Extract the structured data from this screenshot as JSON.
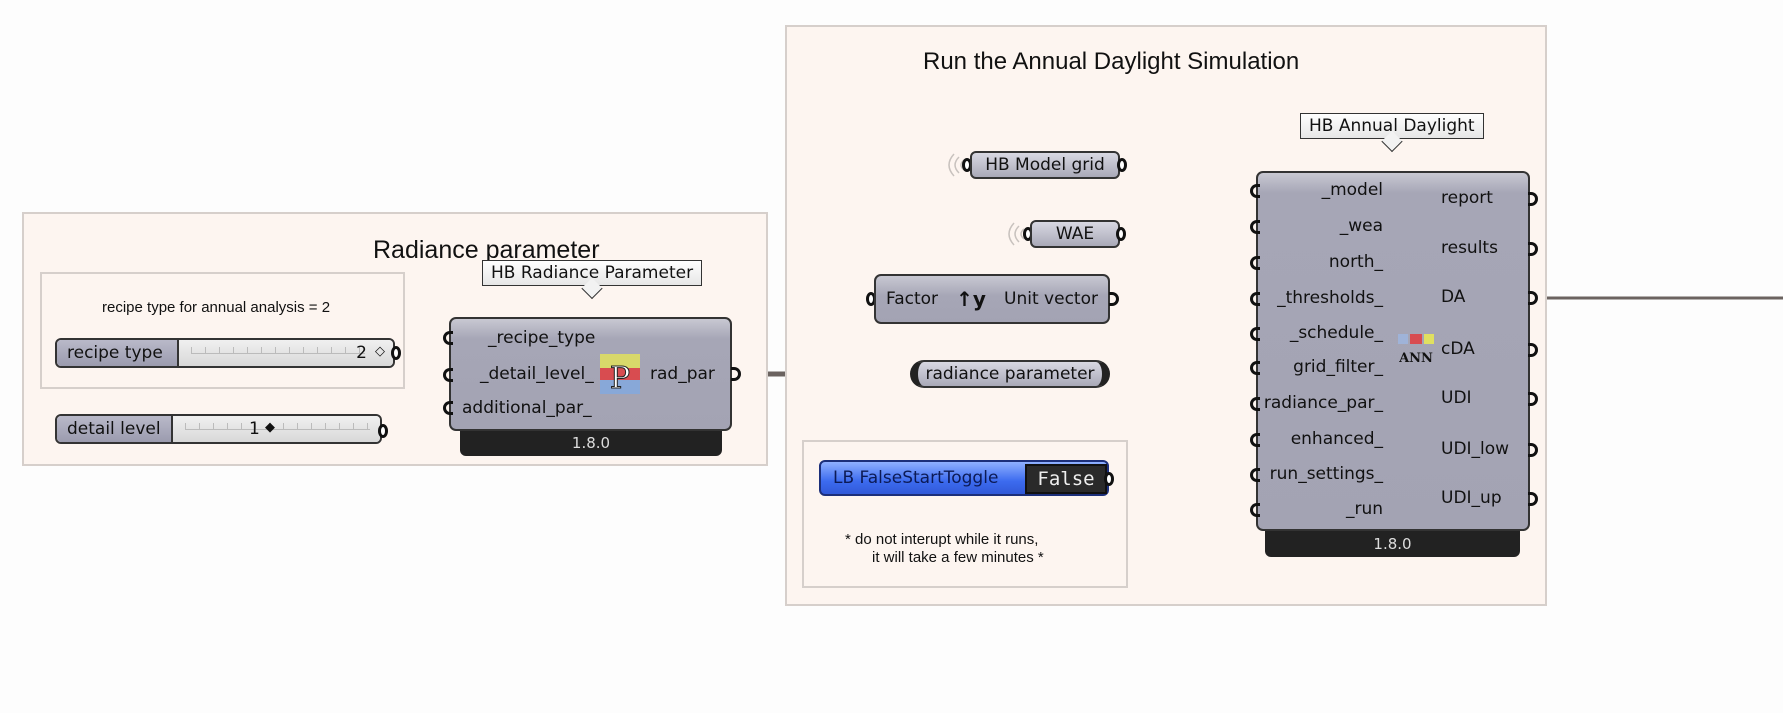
{
  "groups": {
    "radiance": {
      "title": "Radiance parameter"
    },
    "annual": {
      "title": "Run the Annual Daylight Simulation"
    }
  },
  "scribbles": {
    "recipe_note": "recipe type for annual analysis = 2",
    "run_note_line1": "* do not interupt while it runs,",
    "run_note_line2": "it will take a few minutes *"
  },
  "sliders": {
    "recipe_type": {
      "label": "recipe type",
      "value": "2"
    },
    "detail_level": {
      "label": "detail level",
      "value": "1"
    }
  },
  "radiance_component": {
    "tag": "HB Radiance Parameter",
    "inputs": [
      "_recipe_type",
      "_detail_level_",
      "additional_par_"
    ],
    "output": "rad_par",
    "icon": "radiance-parameter-icon",
    "version": "1.8.0"
  },
  "params": {
    "model_grid": "HB Model grid",
    "wea": "WAE",
    "radiance_parameter": "radiance parameter"
  },
  "unit_vector": {
    "left": "Factor",
    "right": "Unit vector",
    "icon": "unit-y-vector-icon",
    "icon_text": "y"
  },
  "toggle": {
    "label": "LB FalseStartToggle",
    "value": "False",
    "color": "#3c6bef"
  },
  "annual_component": {
    "tag": "HB Annual Daylight",
    "inputs": [
      "_model",
      "_wea",
      "north_",
      "_thresholds_",
      "_schedule_",
      "grid_filter_",
      "radiance_par_",
      "enhanced_",
      "run_settings_",
      "_run"
    ],
    "outputs": [
      "report",
      "results",
      "DA",
      "cDA",
      "UDI",
      "UDI_low",
      "UDI_up"
    ],
    "icon": "annual-daylight-icon",
    "icon_text": "ANN",
    "version": "1.8.0"
  },
  "colors": {
    "group_bg": "#fdf5f0",
    "wire": "#6b6360",
    "component": "#a6a6b6"
  }
}
